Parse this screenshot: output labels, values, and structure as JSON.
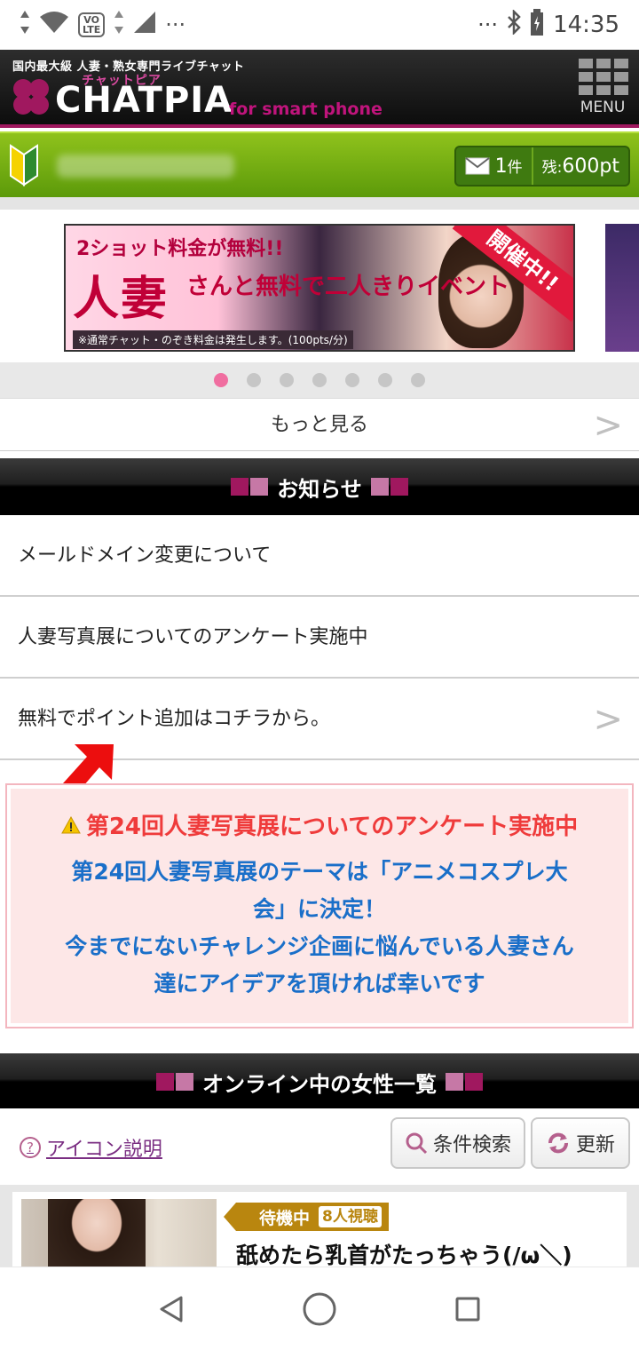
{
  "status_bar": {
    "lte_label": "VO\nLTE",
    "time": "14:35",
    "more_dots": "···"
  },
  "header": {
    "tagline": "国内最大級 人妻・熟女専門ライブチャット",
    "ruby": "チャットピア",
    "logo": "CHATPIA",
    "subtitle": "for smart phone",
    "menu_label": "MENU",
    "brand_color": "#a0185f"
  },
  "user_bar": {
    "mail_count": "1",
    "mail_unit": "件",
    "points_prefix": "残:",
    "points_value": "600pt"
  },
  "banner": {
    "line1": "2ショット料金が無料!!",
    "line2": "人妻",
    "line3": "さんと無料で二人きりイベント",
    "ribbon": "開催中!!",
    "note": "※通常チャット・のぞき料金は発生します。(100pts/分)"
  },
  "carousel": {
    "dot_count": 7,
    "active_index": 0
  },
  "more_link": "もっと見る",
  "news": {
    "heading": "お知らせ",
    "items": [
      "メールドメイン変更について",
      "人妻写真展についてのアンケート実施中",
      "無料でポイント追加はコチラから。"
    ]
  },
  "notice": {
    "title": "第24回人妻写真展についてのアンケート実施中",
    "body_line1": "第24回人妻写真展のテーマは「アニメコスプレ大",
    "body_line2": "会」に決定！",
    "body_line3": "今までにないチャレンジ企画に悩んでいる人妻さん",
    "body_line4": "達にアイデアを頂ければ幸いです",
    "title_color": "#ef3b3b",
    "body_color": "#1a6fc9"
  },
  "online": {
    "heading": "オンライン中の女性一覧",
    "help_link": "アイコン説明",
    "search_button": "条件検索",
    "refresh_button": "更新",
    "performers": [
      {
        "status": "待機中",
        "viewers": "8人視聴",
        "title": "舐めたら乳首がたっちゃう(/ω＼)"
      }
    ]
  }
}
